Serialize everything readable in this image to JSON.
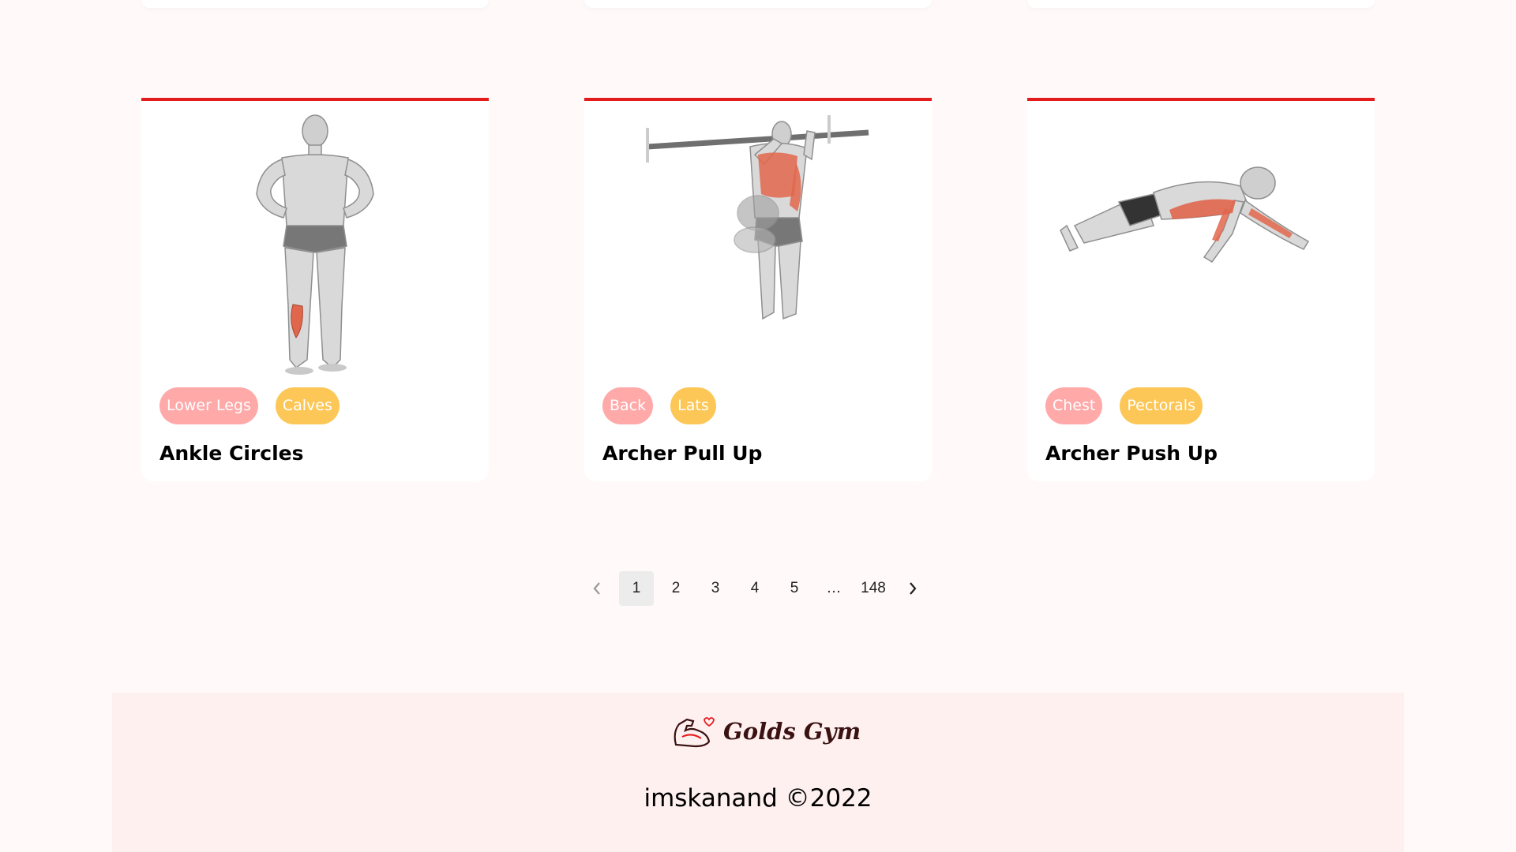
{
  "exercises": [
    {
      "title": "Ankle Circles",
      "body_part": "Lower Legs",
      "target": "Calves",
      "icon": "standing-figure-calves-highlight"
    },
    {
      "title": "Archer Pull Up",
      "body_part": "Back",
      "target": "Lats",
      "icon": "pull-up-bar-figure-back-highlight"
    },
    {
      "title": "Archer Push Up",
      "body_part": "Chest",
      "target": "Pectorals",
      "icon": "push-up-figure-chest-highlight"
    }
  ],
  "pagination": {
    "prev": "‹",
    "pages": [
      "1",
      "2",
      "3",
      "4",
      "5"
    ],
    "ellipsis": "…",
    "last": "148",
    "current": "1"
  },
  "footer": {
    "logo_text": "Golds Gym",
    "copyright": "imskanand ©2022"
  },
  "colors": {
    "accent": "#e41b1b",
    "body_tag": "#ffa9a9",
    "target_tag": "#fcc757",
    "page_bg": "#fff9fa",
    "footer_bg": "#fff0f0",
    "muscle": "#e0664c"
  }
}
